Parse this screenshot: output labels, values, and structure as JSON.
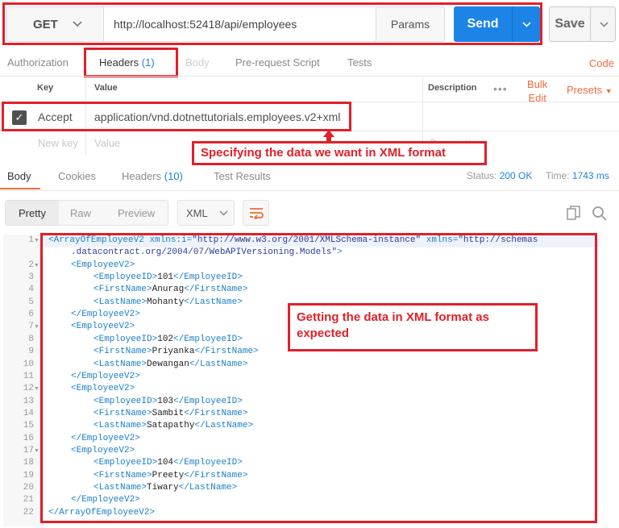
{
  "request": {
    "method": "GET",
    "url": "http://localhost:52418/api/employees",
    "params_label": "Params",
    "send_label": "Send",
    "save_label": "Save"
  },
  "request_tabs": {
    "authorization": "Authorization",
    "headers": "Headers",
    "headers_count": "(1)",
    "body": "Body",
    "prerequest": "Pre-request Script",
    "tests": "Tests",
    "code": "Code"
  },
  "headers_table": {
    "col_key": "Key",
    "col_value": "Value",
    "col_description": "Description",
    "bulk_edit_line1": "Bulk",
    "bulk_edit_line2": "Edit",
    "presets": "Presets",
    "row": {
      "key": "Accept",
      "value": "application/vnd.dotnettutorials.employees.v2+xml"
    },
    "new_key_placeholder": "New key",
    "value_placeholder": "Value",
    "description_placeholder": "Description"
  },
  "annotations": {
    "top": "Specifying the data we want in XML format",
    "bottom": "Getting the data in XML format as expected"
  },
  "response_tabs": {
    "body": "Body",
    "cookies": "Cookies",
    "headers": "Headers",
    "headers_count": "(10)",
    "test_results": "Test Results"
  },
  "response_status": {
    "status_label": "Status:",
    "status_value": "200 OK",
    "time_label": "Time:",
    "time_value": "1743 ms"
  },
  "view_modes": {
    "pretty": "Pretty",
    "raw": "Raw",
    "preview": "Preview",
    "format": "XML"
  },
  "xml": {
    "root_open": "<ArrayOfEmployeeV2",
    "ns_i_attr": "xmlns:i=",
    "ns_i_val": "\"http://www.w3.org/2001/XMLSchema-instance\"",
    "ns_attr": "xmlns=",
    "ns_val_part1": "\"http://schemas",
    "ns_val_part2": ".datacontract.org/2004/07/WebAPIVersioning.Models\"",
    "root_close": "</ArrayOfEmployeeV2>",
    "employees": [
      {
        "id": "101",
        "first": "Anurag",
        "last": "Mohanty"
      },
      {
        "id": "102",
        "first": "Priyanka",
        "last": "Dewangan"
      },
      {
        "id": "103",
        "first": "Sambit",
        "last": "Satapathy"
      },
      {
        "id": "104",
        "first": "Preety",
        "last": "Tiwary"
      }
    ],
    "line_numbers": [
      "1",
      "2",
      "3",
      "4",
      "5",
      "6",
      "7",
      "8",
      "9",
      "10",
      "11",
      "12",
      "13",
      "14",
      "15",
      "16",
      "17",
      "18",
      "19",
      "20",
      "21",
      "22"
    ]
  },
  "icons": {
    "method_chevron": "chevron-down-icon",
    "send_chevron": "chevron-down-icon",
    "save_chevron": "chevron-down-icon",
    "checkbox": "check-icon",
    "wrap": "wrap-lines-icon",
    "copy": "copy-icon",
    "search": "search-icon"
  },
  "colors": {
    "accent": "#f26b3a",
    "send": "#1b84e6",
    "annotation": "#e0202a",
    "count": "#1b84e6"
  }
}
